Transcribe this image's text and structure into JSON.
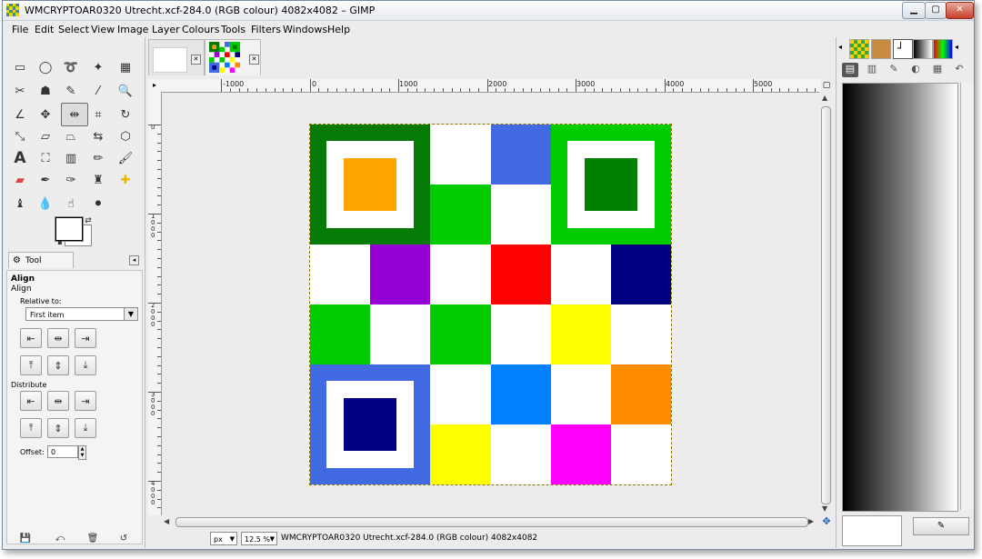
{
  "window": {
    "title": "WMCRYPTOAR0320 Utrecht.xcf-284.0 (RGB colour) 4082x4082 – GIMP"
  },
  "menu": [
    "File",
    "Edit",
    "Select",
    "View",
    "Image",
    "Layer",
    "Colours",
    "Tools",
    "Filters",
    "Windows",
    "Help"
  ],
  "tool_options": {
    "tab_label": "Tool Options",
    "section_title": "Align",
    "tool_name": "Align",
    "relative_to_label": "Relative to:",
    "relative_to_value": "First item",
    "distribute_label": "Distribute",
    "offset_label": "Offset:",
    "offset_value": "0"
  },
  "ruler": {
    "h_labels": [
      "-1000",
      "0",
      "1000",
      "2000",
      "3000",
      "4000",
      "5000"
    ],
    "v_labels": [
      "0",
      "1000",
      "2000",
      "3000",
      "4000"
    ]
  },
  "status": {
    "unit": "px",
    "zoom": "12.5 %",
    "text": "WMCRYPTOAR0320 Utrecht.xcf-284.0 (RGB colour) 4082x4082"
  },
  "image_grid": {
    "rows": [
      [
        "big:#067a06:#ffffff:#ffa500",
        "",
        "#ffffff",
        "#4169e1",
        "big:#00cc00:#ffffff:#007f00",
        ""
      ],
      [
        "",
        "",
        "#00cc00",
        "#ffffff",
        "",
        ""
      ],
      [
        "#ffffff",
        "#9400d3",
        "#ffffff",
        "#ff0000",
        "#ffffff",
        "#000080"
      ],
      [
        "#00cc00",
        "#ffffff",
        "#00cc00",
        "#ffffff",
        "#ffff00",
        "#ffffff"
      ],
      [
        "big:#4169e1:#ffffff:#000080",
        "",
        "#ffffff",
        "#0080ff",
        "#ffffff",
        "#ff8c00"
      ],
      [
        "",
        "",
        "#ffff00",
        "#ffffff",
        "#ff00ff",
        "#ffffff"
      ]
    ]
  },
  "colors": {
    "fg": "#000000",
    "bg": "#ffffff"
  }
}
